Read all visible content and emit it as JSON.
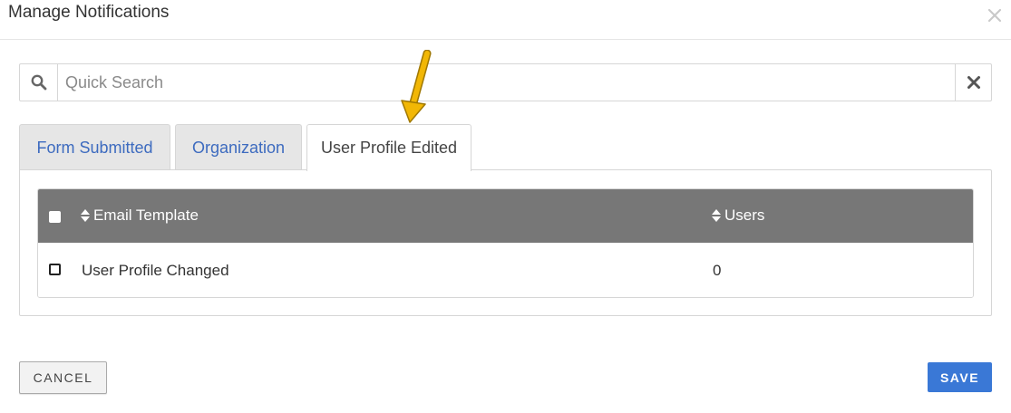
{
  "modal": {
    "title": "Manage Notifications",
    "close_icon": "close-icon"
  },
  "search": {
    "placeholder": "Quick Search",
    "value": "",
    "icon": "search-icon",
    "clear_icon": "clear-icon"
  },
  "tabs": [
    {
      "label": "Form Submitted",
      "active": false
    },
    {
      "label": "Organization",
      "active": false
    },
    {
      "label": "User Profile Edited",
      "active": true
    }
  ],
  "table": {
    "columns": [
      {
        "label": "Email Template",
        "sortable": true
      },
      {
        "label": "Users",
        "sortable": true
      }
    ],
    "rows": [
      {
        "email_template": "User Profile Changed",
        "users": "0",
        "checked": false
      }
    ]
  },
  "footer": {
    "cancel_label": "CANCEL",
    "save_label": "SAVE"
  },
  "colors": {
    "accent": "#3a78d6",
    "tab_link": "#3d6bbf",
    "table_header": "#777777",
    "annotation_arrow": "#f2b705"
  }
}
